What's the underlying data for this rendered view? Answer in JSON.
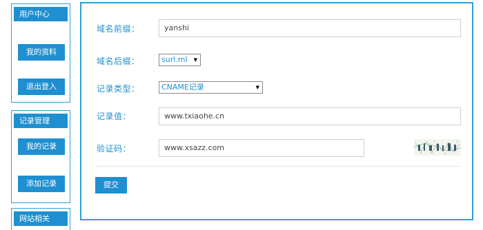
{
  "sidebar": {
    "user_center": {
      "title": "用户中心",
      "items": [
        "我的资料",
        "退出登入"
      ]
    },
    "record_mgmt": {
      "title": "记录管理",
      "items": [
        "我的记录",
        "添加记录"
      ]
    },
    "site_related": {
      "title": "网站相关"
    }
  },
  "form": {
    "prefix_label": "域名前缀：",
    "prefix_value": "yanshi",
    "suffix_label": "域名后缀：",
    "suffix_value": "surl.ml",
    "type_label": "记录类型：",
    "type_value": "CNAME记录",
    "value_label": "记录值：",
    "value_value": "www.txiaohe.cn",
    "captcha_label": "验证码：",
    "captcha_value": "www.xsazz.com",
    "submit_label": "提交"
  },
  "colors": {
    "accent": "#1e8fd0",
    "border": "#2a9fd6"
  }
}
